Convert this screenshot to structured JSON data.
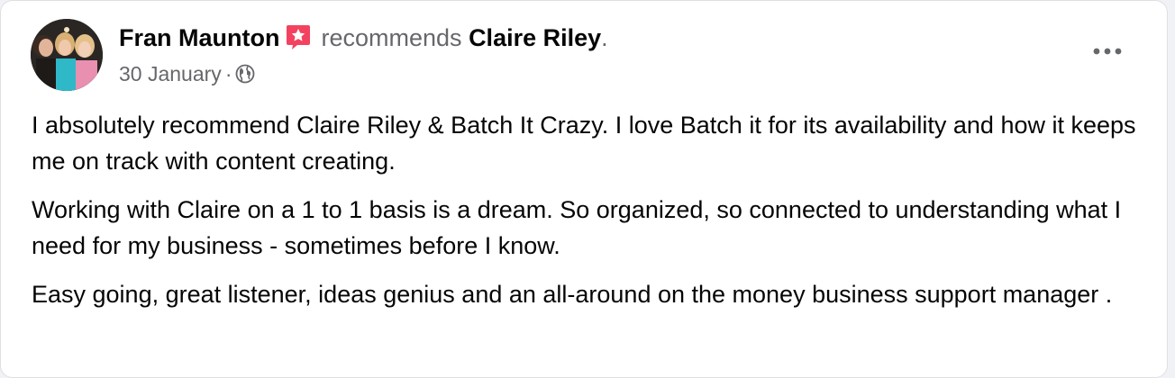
{
  "post": {
    "author": "Fran Maunton",
    "verb": "recommends",
    "target": "Claire Riley",
    "target_suffix": ".",
    "date": "30 January",
    "separator": "·",
    "audience_icon": "globe-icon",
    "badge_icon": "recommendation-star-icon",
    "more_icon": "more-options-icon",
    "paragraphs": [
      "I absolutely recommend Claire Riley & Batch It Crazy. I love Batch it for its availability and how it keeps me on track with content creating.",
      "Working with Claire on a 1 to 1 basis is a dream. So organized, so connected to understanding what I need for my business - sometimes before I know.",
      "Easy going, great listener, ideas genius and an all-around on the money business support manager ."
    ]
  },
  "colors": {
    "badge": "#f3425f",
    "secondary_text": "#65676b",
    "primary_text": "#050505"
  }
}
